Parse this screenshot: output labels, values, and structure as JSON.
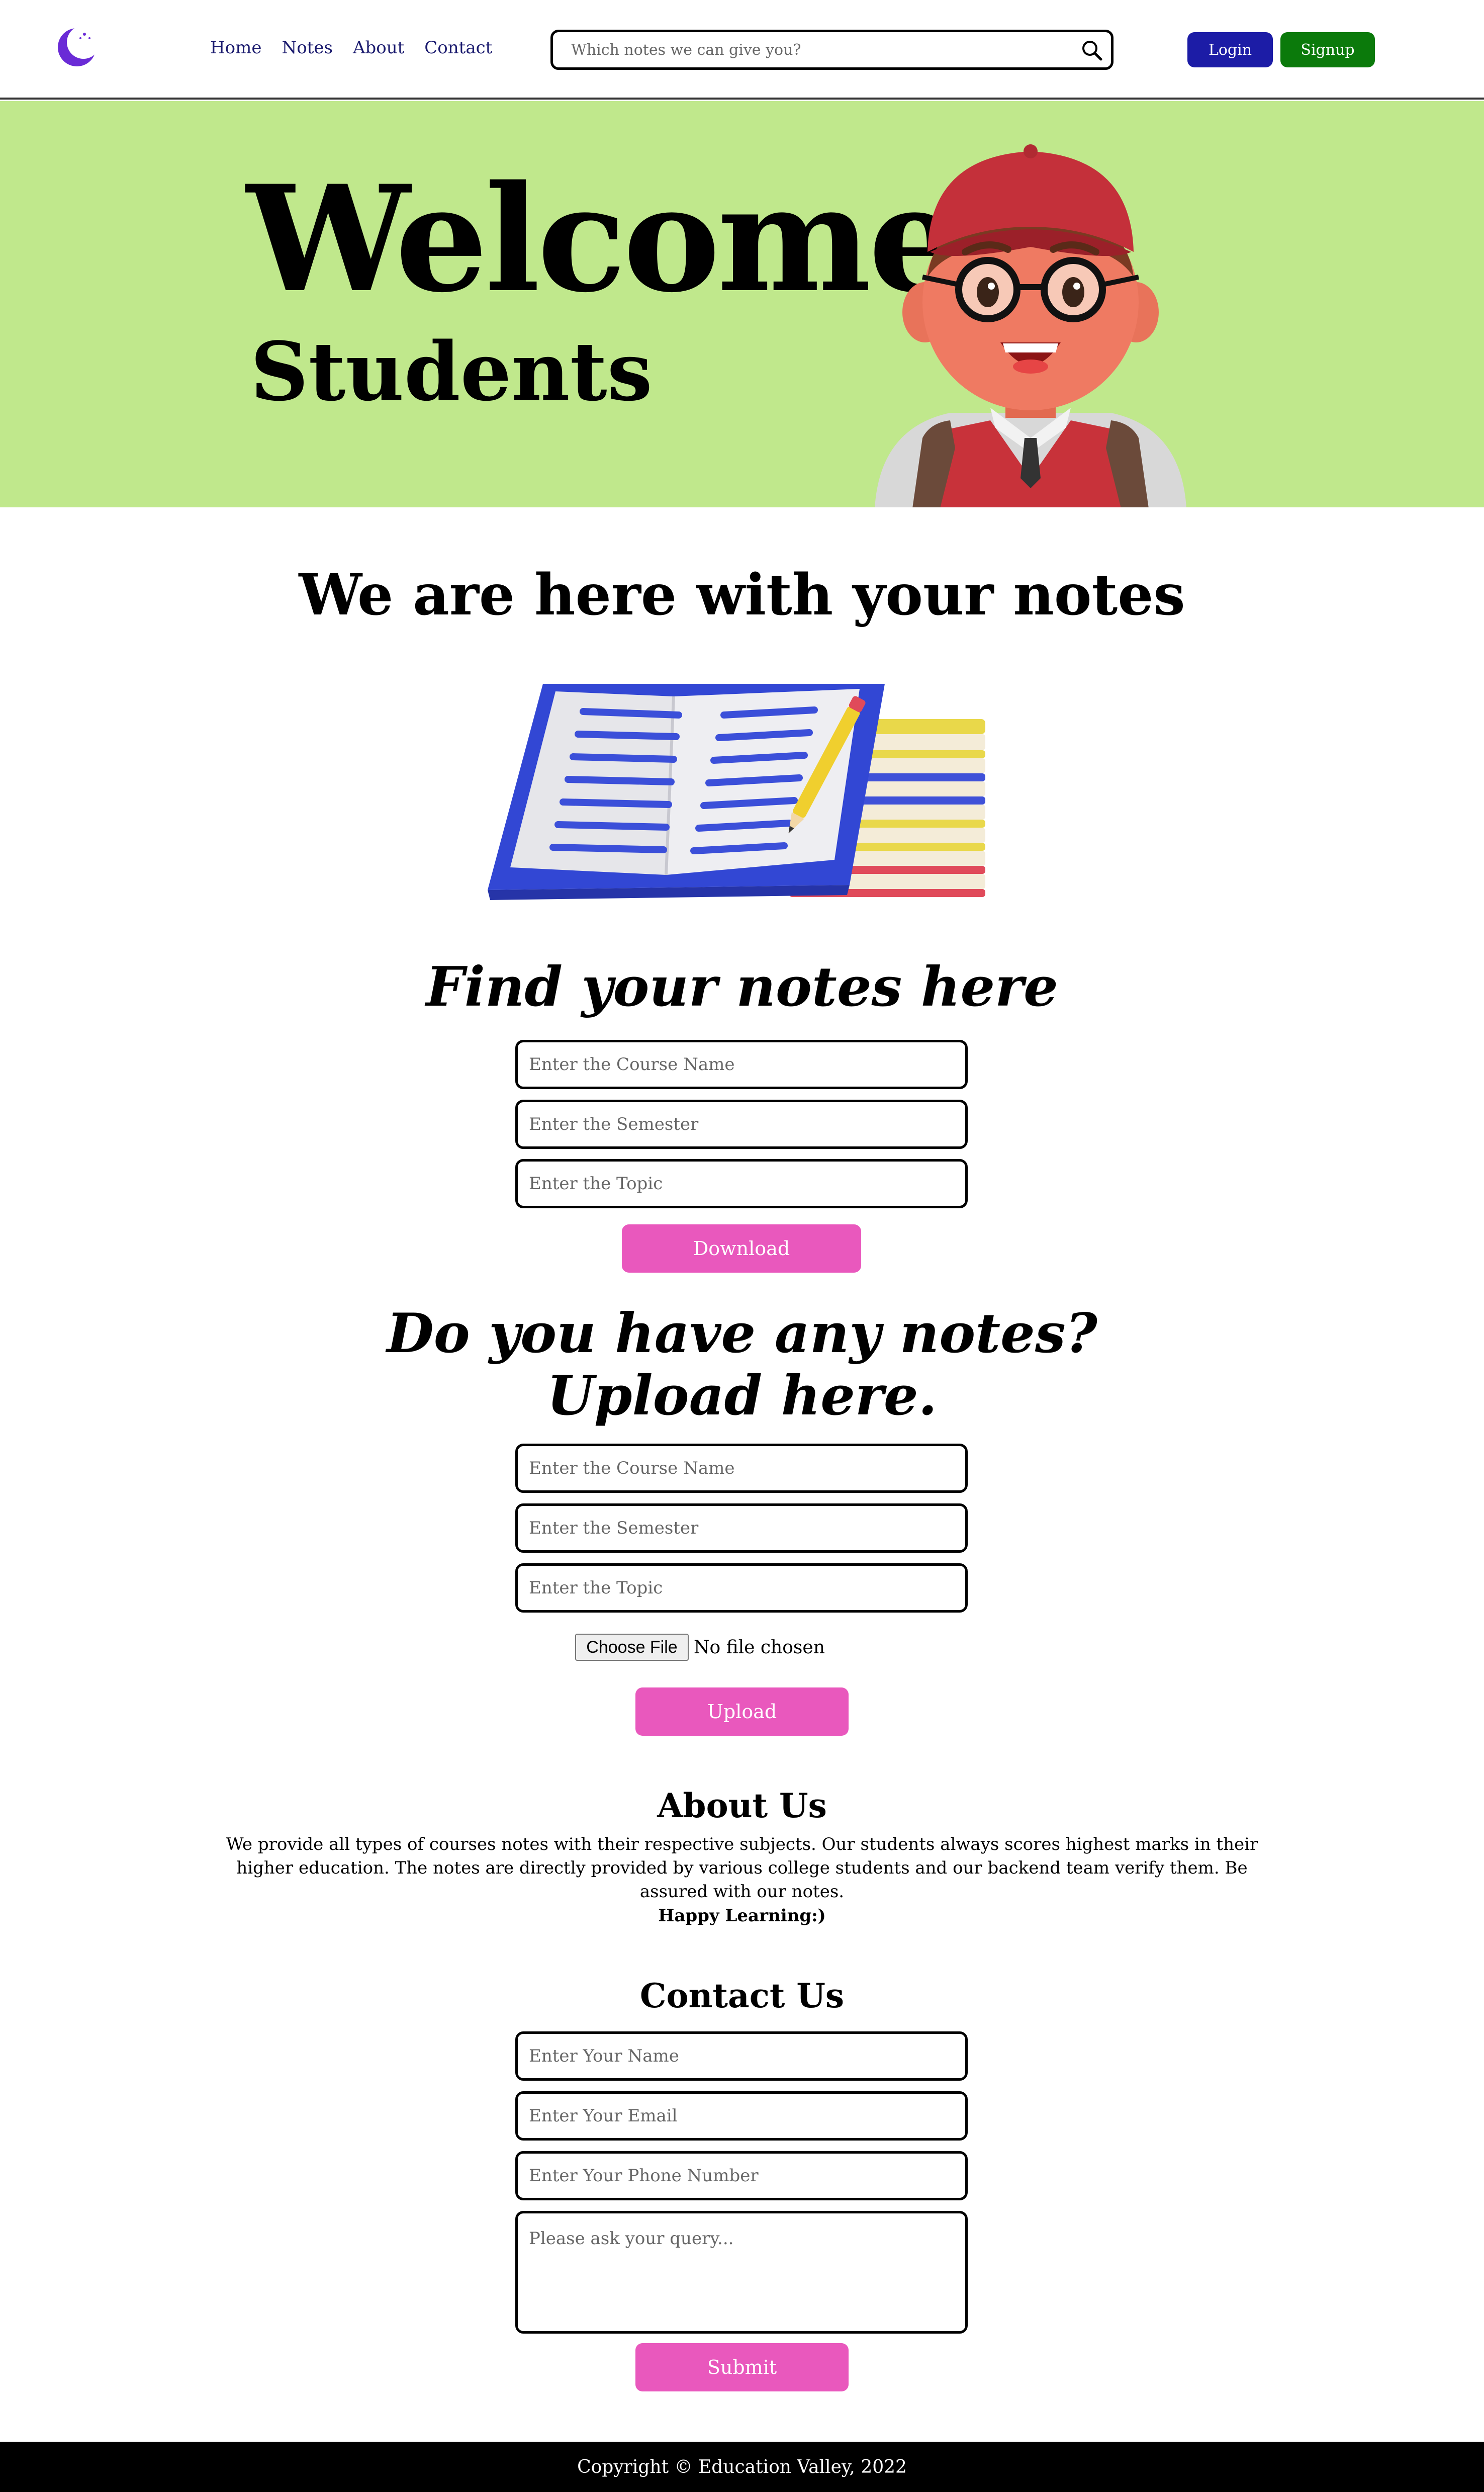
{
  "nav": {
    "logo_icon": "crescent-moon-logo-icon",
    "links": [
      {
        "label": "Home"
      },
      {
        "label": "Notes"
      },
      {
        "label": "About"
      },
      {
        "label": "Contact"
      }
    ],
    "search_placeholder": "Which notes we can give you?",
    "search_icon": "search-icon",
    "login_label": "Login",
    "signup_label": "Signup",
    "login_color": "#1c1ca6",
    "signup_color": "#0b7a0b"
  },
  "hero": {
    "title": "Welcome",
    "subtitle": "Students",
    "background_color": "#c0e88c",
    "illustration": "student-avatar-illustration"
  },
  "notes_section": {
    "heading": "We are here with your notes",
    "illustration": "books-illustration"
  },
  "find_section": {
    "heading": "Find your notes here",
    "course_placeholder": "Enter the Course Name",
    "semester_placeholder": "Enter the Semester",
    "topic_placeholder": "Enter the Topic",
    "download_label": "Download"
  },
  "upload_section": {
    "heading_line1": "Do you have any notes?",
    "heading_line2": "Upload here.",
    "course_placeholder": "Enter the Course Name",
    "semester_placeholder": "Enter the Semester",
    "topic_placeholder": "Enter the Topic",
    "choose_file_label": "Choose File",
    "file_status": "No file chosen",
    "upload_label": "Upload"
  },
  "about": {
    "heading": "About Us",
    "text": "We provide all types of courses notes with their respective subjects. Our students always scores highest marks in their higher education. The notes are directly provided by various college students and our backend team verify them. Be assured with our notes.",
    "closing": "Happy Learning:)"
  },
  "contact": {
    "heading": "Contact Us",
    "name_placeholder": "Enter Your Name",
    "email_placeholder": "Enter Your Email",
    "phone_placeholder": "Enter Your Phone Number",
    "query_placeholder": "Please ask your query...",
    "submit_label": "Submit"
  },
  "footer": {
    "text": "Copyright © Education Valley, 2022"
  },
  "colors": {
    "accent_pink": "#e958bd",
    "nav_link": "#1a1a6e"
  }
}
